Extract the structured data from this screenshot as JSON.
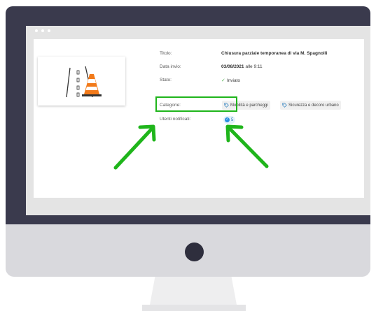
{
  "detail": {
    "fields": [
      {
        "label": "Titolo:",
        "value": "Chiusura parziale temporanea di via M. Spagnolli"
      },
      {
        "label": "Data invio:",
        "value_date": "03/08/2021",
        "value_suffix": "alle 9:11"
      },
      {
        "label": "Stato:",
        "value": "Inviato"
      },
      {
        "label": "Categorie:"
      },
      {
        "label": "Utenti notificati:",
        "value": "5"
      }
    ],
    "categories": [
      "Mobilità e parcheggi",
      "Sicurezza e decoro urbano"
    ]
  },
  "colors": {
    "monitor": "#3a3a4d",
    "highlight": "#1fb51b",
    "check": "#5cb85c",
    "badge": "#2b8fe0",
    "tag_icon": "#4a90c6"
  },
  "icons": [
    "road-cone-icon",
    "check-icon",
    "tag-icon",
    "user-badge-icon",
    "arrow-icon"
  ]
}
